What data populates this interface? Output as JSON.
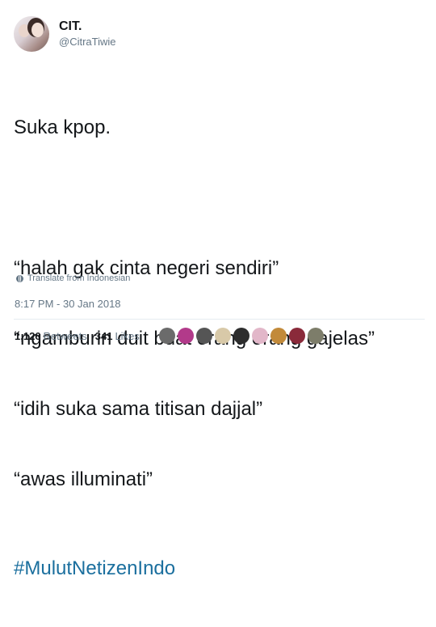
{
  "user": {
    "display_name": "CIT.",
    "handle": "@CitraTiwie"
  },
  "tweet": {
    "lines": [
      "Suka kpop.",
      "“halah gak cinta negeri sendiri”",
      "“ngamburin duit buat orang orang gajelas”",
      "“idih suka sama titisan dajjal”",
      "“awas illuminati”"
    ],
    "hashtag": "#MulutNetizenIndo",
    "translate_label": "Translate from Indonesian",
    "timestamp": "8:17 PM - 30 Jan 2018"
  },
  "stats": {
    "retweets_count": "1,126",
    "retweets_label": "Retweets",
    "likes_count": "341",
    "likes_label": "Likes"
  },
  "likers": [
    {
      "name": "liker-avatar",
      "color": "#6b6b6b"
    },
    {
      "name": "liker-avatar",
      "color": "#b23a8a"
    },
    {
      "name": "liker-avatar",
      "color": "#555555"
    },
    {
      "name": "liker-avatar",
      "color": "#d8c9a8"
    },
    {
      "name": "liker-avatar",
      "color": "#2d2d2d"
    },
    {
      "name": "liker-avatar",
      "color": "#e2b7c9"
    },
    {
      "name": "liker-avatar",
      "color": "#c28a3a"
    },
    {
      "name": "liker-avatar",
      "color": "#8a2a3a"
    },
    {
      "name": "liker-avatar",
      "color": "#7d7d6a"
    }
  ],
  "colors": {
    "hashtag": "#1b6f9e",
    "secondary_text": "#657786",
    "primary_text": "#14171a"
  }
}
